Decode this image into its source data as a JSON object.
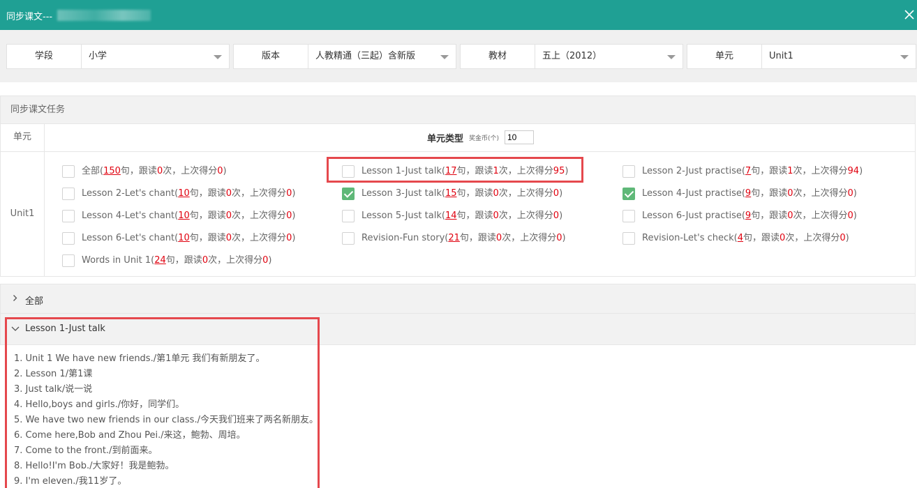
{
  "window": {
    "title": "同步课文---"
  },
  "filters": [
    {
      "label": "学段",
      "value": "小学"
    },
    {
      "label": "版本",
      "value": "人教精通（三起）含新版"
    },
    {
      "label": "教材",
      "value": "五上（2012）"
    },
    {
      "label": "单元",
      "value": "Unit1"
    }
  ],
  "tasks": {
    "panel_title": "同步课文任务",
    "col_unit": "单元",
    "col_type": "单元类型",
    "coin_label": "奖金币(个)",
    "coin_value": "10",
    "unit_name": "Unit1",
    "items": [
      {
        "name": "全部",
        "count": "150",
        "reads": "0",
        "score": "0",
        "checked": false
      },
      {
        "name": "Lesson 1-Just talk",
        "count": "17",
        "reads": "1",
        "score": "95",
        "checked": false
      },
      {
        "name": "Lesson 2-Just practise",
        "count": "7",
        "reads": "1",
        "score": "94",
        "checked": false
      },
      {
        "name": "Lesson 2-Let's chant",
        "count": "10",
        "reads": "0",
        "score": "0",
        "checked": false
      },
      {
        "name": "Lesson 3-Just talk",
        "count": "15",
        "reads": "0",
        "score": "0",
        "checked": true
      },
      {
        "name": "Lesson 4-Just practise",
        "count": "9",
        "reads": "0",
        "score": "0",
        "checked": true
      },
      {
        "name": "Lesson 4-Let's chant",
        "count": "10",
        "reads": "0",
        "score": "0",
        "checked": false
      },
      {
        "name": "Lesson 5-Just talk",
        "count": "14",
        "reads": "0",
        "score": "0",
        "checked": false
      },
      {
        "name": "Lesson 6-Just practise",
        "count": "9",
        "reads": "0",
        "score": "0",
        "checked": false
      },
      {
        "name": "Lesson 6-Let's chant",
        "count": "10",
        "reads": "0",
        "score": "0",
        "checked": false
      },
      {
        "name": "Revision-Fun story",
        "count": "21",
        "reads": "0",
        "score": "0",
        "checked": false
      },
      {
        "name": "Revision-Let's check",
        "count": "4",
        "reads": "0",
        "score": "0",
        "checked": false
      },
      {
        "name": "Words in Unit 1",
        "count": "24",
        "reads": "0",
        "score": "0",
        "checked": false
      }
    ],
    "text": {
      "sent": "句，跟读",
      "times": "次，上次得分",
      "close": ")"
    }
  },
  "accordion": {
    "all_label": "全部",
    "open_label": "Lesson 1-Just talk",
    "sentences": [
      "1. Unit 1 We have new friends./第1单元 我们有新朋友了。",
      "2. Lesson 1/第1课",
      "3. Just talk/说一说",
      "4. Hello,boys and girls./你好，同学们。",
      "5. We have two new friends in our class./今天我们班来了两名新朋友。",
      "6. Come here,Bob and Zhou Pei./来这，鲍勃、周培。",
      "7. Come to the front./到前面来。",
      "8. Hello!I'm Bob./大家好！我是鲍勃。",
      "9. I'm eleven./我11岁了。"
    ]
  },
  "colors": {
    "header": "#1fa094",
    "highlight": "#e5484d",
    "number": "#e0000e",
    "check": "#5fb878"
  }
}
